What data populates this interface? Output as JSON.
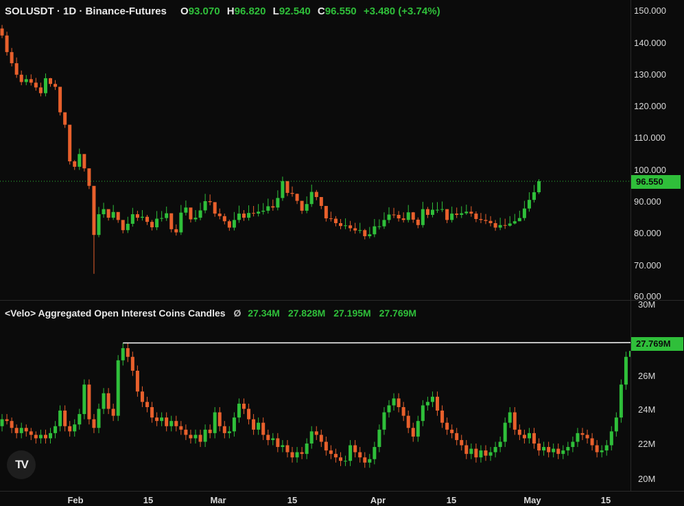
{
  "symbol_line": "SOLUSDT · 1D · Binance-Futures",
  "ohlc": {
    "o_label": "O",
    "o": "93.070",
    "h_label": "H",
    "h": "96.820",
    "l_label": "L",
    "l": "92.540",
    "c_label": "C",
    "c": "96.550",
    "change": "+3.480 (+3.74%)"
  },
  "price_axis_labels": [
    "150.000",
    "140.000",
    "130.000",
    "120.000",
    "110.000",
    "100.000",
    "90.000",
    "80.000",
    "70.000",
    "60.000"
  ],
  "current_price_tag": "96.550",
  "oi_legend": {
    "name": "<Velo> Aggregated Open Interest Coins Candles",
    "sep": "Ø",
    "o": "27.34M",
    "h": "27.828M",
    "l": "27.195M",
    "c": "27.769M"
  },
  "oi_axis_labels": [
    "30M",
    "26M",
    "24M",
    "22M",
    "20M"
  ],
  "current_oi_tag": "27.769M",
  "time_labels": [
    "Feb",
    "15",
    "Mar",
    "15",
    "Apr",
    "15",
    "May",
    "15"
  ],
  "logo_text": "TV",
  "colors": {
    "up": "#2fbf3a",
    "down": "#e8602c",
    "background": "#0b0b0b",
    "ref_line": "#ffffff"
  },
  "chart_data": [
    {
      "type": "candlestick",
      "title": "SOLUSDT · 1D · Binance-Futures",
      "ylim": [
        60,
        150
      ],
      "x": [
        "Jan 18",
        "Jan 19",
        "Jan 20",
        "Jan 21",
        "Jan 22",
        "Jan 23",
        "Jan 24",
        "Jan 25",
        "Jan 26",
        "Jan 27",
        "Jan 28",
        "Jan 29",
        "Jan 30",
        "Jan 31",
        "Feb 1",
        "Feb 2",
        "Feb 3",
        "Feb 4",
        "Feb 5",
        "Feb 6",
        "Feb 7",
        "Feb 8",
        "Feb 9",
        "Feb 10",
        "Feb 11",
        "Feb 12",
        "Feb 13",
        "Feb 14",
        "Feb 15",
        "Feb 16",
        "Feb 17",
        "Feb 18",
        "Feb 19",
        "Feb 20",
        "Feb 21",
        "Feb 22",
        "Feb 23",
        "Feb 24",
        "Feb 25",
        "Feb 26",
        "Feb 27",
        "Feb 28",
        "Mar 1",
        "Mar 2",
        "Mar 3",
        "Mar 4",
        "Mar 5",
        "Mar 6",
        "Mar 7",
        "Mar 8",
        "Mar 9",
        "Mar 10",
        "Mar 11",
        "Mar 12",
        "Mar 13",
        "Mar 14",
        "Mar 15",
        "Mar 16",
        "Mar 17",
        "Mar 18",
        "Mar 19",
        "Mar 20",
        "Mar 21",
        "Mar 22",
        "Mar 23",
        "Mar 24",
        "Mar 25",
        "Mar 26",
        "Mar 27",
        "Mar 28",
        "Mar 29",
        "Mar 30",
        "Mar 31",
        "Apr 1",
        "Apr 2",
        "Apr 3",
        "Apr 4",
        "Apr 5",
        "Apr 6",
        "Apr 7",
        "Apr 8",
        "Apr 9",
        "Apr 10",
        "Apr 11",
        "Apr 12",
        "Apr 13",
        "Apr 14",
        "Apr 15",
        "Apr 16",
        "Apr 17",
        "Apr 18",
        "Apr 19",
        "Apr 20",
        "Apr 21",
        "Apr 22",
        "Apr 23",
        "Apr 24",
        "Apr 25",
        "Apr 26",
        "Apr 27",
        "Apr 28",
        "Apr 29",
        "Apr 30",
        "May 1",
        "May 2",
        "May 3",
        "May 4",
        "May 5",
        "May 6",
        "May 7",
        "May 8",
        "May 9",
        "May 10",
        "May 11",
        "May 12",
        "May 13",
        "May 14",
        "May 15",
        "May 16",
        "May 17",
        "May 18",
        "May 19",
        "May 20",
        "May 21",
        "May 22",
        "May 23",
        "May 24",
        "May 25",
        "May 26",
        "May 27",
        "May 28",
        "May 29",
        "May 30",
        "May 31",
        "Jun 1",
        "Jun 2",
        "Jun 3",
        "Jun 4",
        "Jun 5",
        "Jun 6"
      ],
      "open": [
        144.5,
        142.3,
        137.1,
        133.6,
        130.0,
        127.7,
        128.6,
        127.5,
        126.0,
        124.2,
        128.9,
        127.1,
        126.2,
        118.2,
        114.3,
        102.8,
        101.1,
        105.1,
        100.6,
        95.1,
        79.7,
        86.2,
        87.8,
        85.1,
        86.9,
        84.4,
        81.2,
        83.2,
        86.2,
        85.1,
        85.4,
        83.8,
        82.1,
        84.8,
        85.0,
        86.5,
        81.5,
        80.5,
        86.7,
        88.3,
        84.6,
        85.1,
        87.4,
        90.3,
        90.0,
        86.4,
        85.6,
        84.0,
        82.0,
        84.4,
        86.4,
        85.1,
        86.6,
        86.4,
        87.0,
        87.3,
        88.7,
        88.3,
        91.3,
        96.6,
        92.9,
        92.6,
        90.4,
        87.3,
        89.4,
        93.2,
        91.6,
        88.8,
        84.9,
        84.8,
        83.4,
        82.5,
        82.7,
        81.8,
        81.1,
        81.2,
        79.3,
        79.9,
        82.4,
        82.4,
        84.4,
        86.1,
        86.0,
        84.9,
        84.4,
        86.8,
        84.5,
        82.8,
        87.8,
        86.0,
        87.6,
        87.6,
        87.8,
        84.4,
        86.4,
        86.0,
        86.5,
        87.0,
        86.4,
        84.7,
        84.4,
        84.1,
        83.4,
        82.0,
        82.8,
        82.6,
        83.3,
        84.0,
        85.0,
        88.0,
        90.7,
        93.1
      ],
      "close": [
        142.3,
        137.1,
        133.6,
        130.0,
        127.7,
        128.6,
        127.5,
        126.0,
        124.2,
        128.9,
        127.1,
        126.2,
        118.2,
        114.3,
        102.8,
        101.1,
        105.1,
        100.6,
        95.1,
        79.7,
        86.2,
        87.8,
        85.1,
        86.9,
        84.4,
        81.2,
        83.2,
        86.2,
        85.1,
        85.4,
        83.8,
        82.1,
        84.8,
        85.0,
        86.5,
        81.5,
        80.5,
        86.7,
        88.3,
        84.6,
        85.1,
        87.4,
        90.3,
        90.0,
        86.4,
        85.6,
        84.0,
        82.0,
        84.4,
        86.4,
        85.1,
        86.6,
        86.4,
        87.0,
        87.3,
        88.7,
        88.3,
        91.3,
        96.6,
        92.9,
        92.6,
        90.4,
        87.3,
        89.4,
        93.2,
        91.6,
        88.8,
        84.9,
        84.8,
        83.4,
        82.5,
        82.7,
        81.8,
        81.1,
        81.2,
        79.3,
        79.9,
        82.4,
        82.4,
        84.4,
        86.1,
        86.0,
        84.9,
        84.4,
        86.8,
        84.5,
        82.8,
        87.8,
        86.0,
        87.6,
        87.6,
        87.8,
        84.4,
        86.4,
        86.0,
        86.5,
        87.0,
        86.4,
        84.7,
        84.4,
        84.1,
        83.4,
        82.0,
        82.8,
        82.6,
        83.3,
        84.0,
        85.0,
        88.0,
        90.7,
        93.1,
        96.55
      ],
      "high": [
        145.6,
        143.5,
        138.4,
        135.4,
        131.3,
        129.9,
        130.1,
        129.0,
        127.5,
        130.4,
        129.0,
        128.3,
        120.0,
        116.3,
        104.5,
        103.2,
        106.8,
        102.6,
        97.1,
        90.0,
        88.5,
        89.8,
        87.6,
        89.1,
        86.6,
        83.7,
        85.4,
        88.2,
        87.3,
        87.5,
        86.0,
        84.4,
        87.2,
        87.2,
        88.6,
        84.1,
        83.0,
        89.1,
        90.5,
        87.0,
        87.5,
        89.8,
        92.6,
        92.4,
        88.9,
        88.0,
        86.4,
        84.5,
        86.9,
        88.9,
        87.5,
        89.0,
        88.8,
        89.4,
        89.7,
        91.1,
        90.8,
        93.7,
        98.0,
        95.2,
        94.9,
        92.7,
        89.8,
        91.8,
        95.5,
        93.8,
        91.1,
        87.3,
        87.0,
        85.6,
        84.7,
        84.9,
        84.1,
        83.5,
        83.5,
        81.6,
        82.2,
        84.7,
        84.6,
        86.8,
        88.4,
        88.2,
        87.2,
        86.8,
        89.1,
        86.9,
        85.2,
        90.1,
        88.5,
        89.9,
        90.0,
        90.2,
        86.8,
        88.6,
        88.3,
        88.7,
        89.2,
        88.7,
        87.1,
        86.6,
        86.3,
        85.6,
        84.4,
        85.1,
        84.8,
        85.6,
        86.3,
        87.3,
        90.4,
        93.1,
        95.4,
        97.2
      ],
      "low": [
        141.5,
        136.0,
        132.6,
        129.0,
        126.7,
        126.7,
        126.6,
        125.0,
        123.2,
        123.2,
        126.2,
        125.2,
        117.2,
        113.3,
        101.8,
        100.1,
        100.1,
        99.6,
        94.1,
        67.5,
        79.0,
        85.1,
        84.2,
        84.4,
        83.5,
        80.2,
        80.3,
        82.3,
        84.1,
        84.2,
        82.8,
        81.1,
        81.2,
        83.9,
        84.1,
        80.5,
        79.5,
        79.7,
        85.8,
        83.6,
        83.8,
        84.3,
        86.5,
        89.0,
        85.4,
        84.6,
        83.0,
        81.0,
        81.1,
        83.5,
        84.1,
        84.2,
        85.5,
        85.5,
        86.1,
        86.4,
        87.3,
        87.4,
        90.4,
        91.9,
        91.7,
        89.4,
        86.3,
        86.5,
        88.5,
        90.6,
        87.8,
        83.9,
        83.9,
        82.4,
        81.5,
        81.5,
        80.8,
        80.1,
        80.2,
        78.3,
        78.6,
        79.0,
        81.4,
        81.6,
        83.4,
        85.0,
        83.9,
        83.6,
        83.6,
        83.5,
        81.8,
        82.0,
        85.0,
        85.2,
        86.6,
        86.9,
        83.4,
        83.6,
        85.0,
        85.0,
        86.0,
        85.4,
        83.7,
        83.4,
        83.1,
        82.4,
        81.0,
        81.2,
        81.6,
        82.3,
        83.0,
        84.0,
        84.2,
        87.0,
        89.9,
        92.54
      ]
    },
    {
      "type": "candlestick",
      "title": "<Velo> Aggregated Open Interest Coins Candles",
      "ylim": [
        20,
        30
      ],
      "unit": "M",
      "open": [
        23.0,
        23.4,
        23.3,
        22.9,
        22.6,
        22.9,
        22.7,
        22.5,
        22.3,
        22.5,
        22.3,
        22.6,
        23.0,
        23.9,
        23.0,
        22.7,
        23.1,
        23.7,
        25.4,
        23.4,
        22.9,
        24.0,
        24.9,
        24.0,
        23.6,
        26.8,
        27.5,
        27.0,
        26.2,
        25.0,
        24.4,
        24.1,
        23.5,
        23.3,
        23.5,
        23.0,
        23.3,
        23.0,
        22.8,
        22.5,
        22.3,
        22.5,
        22.1,
        22.8,
        22.6,
        23.8,
        23.0,
        22.6,
        22.7,
        23.5,
        24.3,
        24.0,
        23.4,
        22.8,
        23.2,
        22.5,
        22.2,
        22.3,
        21.8,
        21.9,
        21.5,
        21.2,
        21.5,
        21.4,
        22.0,
        22.7,
        22.5,
        22.1,
        21.6,
        21.4,
        21.2,
        21.0,
        21.0,
        21.9,
        21.5,
        21.2,
        20.9,
        21.1,
        21.8,
        22.8,
        23.8,
        24.2,
        24.6,
        24.1,
        23.6,
        22.9,
        22.4,
        23.3,
        24.2,
        24.4,
        24.7,
        23.9,
        23.2,
        22.8,
        22.6,
        22.2,
        21.9,
        21.4,
        21.7,
        21.2,
        21.6,
        21.3,
        21.5,
        21.8,
        22.1,
        23.2,
        23.8,
        22.8,
        22.5,
        22.3,
        22.6,
        22.0,
        21.6,
        21.8,
        21.5,
        21.7,
        21.4,
        21.6,
        21.8,
        22.1,
        22.6,
        22.5,
        22.3,
        21.9,
        21.5,
        21.6,
        21.9,
        22.7,
        23.5,
        25.4,
        27.0,
        27.34
      ],
      "close": [
        23.4,
        23.3,
        22.9,
        22.6,
        22.9,
        22.7,
        22.5,
        22.3,
        22.5,
        22.3,
        22.6,
        23.0,
        23.9,
        23.0,
        22.7,
        23.1,
        23.7,
        25.4,
        23.4,
        22.9,
        24.0,
        24.9,
        24.0,
        23.6,
        26.8,
        27.5,
        27.0,
        26.2,
        25.0,
        24.4,
        24.1,
        23.5,
        23.3,
        23.5,
        23.0,
        23.3,
        23.0,
        22.8,
        22.5,
        22.3,
        22.5,
        22.1,
        22.8,
        22.6,
        23.8,
        23.0,
        22.6,
        22.7,
        23.5,
        24.3,
        24.0,
        23.4,
        22.8,
        23.2,
        22.5,
        22.2,
        22.3,
        21.8,
        21.9,
        21.5,
        21.2,
        21.5,
        21.4,
        22.0,
        22.7,
        22.5,
        22.1,
        21.6,
        21.4,
        21.2,
        21.0,
        21.0,
        21.9,
        21.5,
        21.2,
        20.9,
        21.1,
        21.8,
        22.8,
        23.8,
        24.2,
        24.6,
        24.1,
        23.6,
        22.9,
        22.4,
        23.3,
        24.2,
        24.4,
        24.7,
        23.9,
        23.2,
        22.8,
        22.6,
        22.2,
        21.9,
        21.4,
        21.7,
        21.2,
        21.6,
        21.3,
        21.5,
        21.8,
        22.1,
        23.2,
        23.8,
        22.8,
        22.5,
        22.3,
        22.6,
        22.0,
        21.6,
        21.8,
        21.5,
        21.7,
        21.4,
        21.6,
        21.8,
        22.1,
        22.6,
        22.5,
        22.3,
        21.9,
        21.5,
        21.6,
        21.9,
        22.7,
        23.5,
        25.4,
        27.0,
        27.34,
        27.769
      ],
      "high": [
        23.7,
        23.7,
        23.5,
        23.1,
        23.2,
        23.1,
        22.9,
        22.7,
        22.8,
        22.8,
        22.9,
        23.3,
        24.2,
        24.2,
        23.3,
        23.4,
        24.0,
        25.7,
        25.7,
        23.7,
        24.3,
        25.2,
        25.2,
        24.3,
        27.1,
        27.8,
        27.8,
        27.3,
        26.5,
        25.3,
        24.7,
        24.4,
        23.8,
        23.8,
        23.8,
        23.6,
        23.6,
        23.3,
        23.1,
        22.8,
        22.8,
        22.8,
        23.1,
        23.1,
        24.1,
        24.1,
        23.3,
        23.0,
        23.8,
        24.6,
        24.6,
        24.3,
        23.7,
        23.5,
        23.5,
        22.8,
        22.6,
        22.6,
        22.2,
        22.2,
        21.8,
        21.8,
        21.8,
        22.3,
        23.0,
        23.0,
        22.8,
        22.4,
        21.9,
        21.7,
        21.5,
        21.3,
        22.2,
        22.2,
        21.8,
        21.5,
        21.4,
        22.1,
        23.1,
        24.1,
        24.5,
        24.9,
        24.9,
        24.4,
        23.9,
        23.2,
        23.6,
        24.5,
        24.7,
        25.0,
        25.0,
        24.2,
        23.5,
        23.1,
        22.9,
        22.5,
        22.2,
        22.0,
        22.0,
        21.9,
        21.9,
        21.8,
        22.1,
        22.4,
        23.5,
        24.1,
        24.1,
        23.1,
        22.8,
        22.9,
        22.9,
        22.3,
        22.1,
        22.1,
        22.0,
        22.0,
        21.9,
        22.1,
        22.4,
        22.9,
        22.9,
        22.8,
        22.6,
        22.2,
        21.9,
        22.2,
        23.0,
        23.8,
        25.7,
        27.3,
        27.6,
        27.828
      ],
      "low": [
        22.7,
        23.1,
        22.6,
        22.3,
        22.3,
        22.4,
        22.2,
        22.0,
        22.0,
        22.0,
        22.0,
        22.3,
        22.7,
        22.7,
        22.4,
        22.4,
        22.8,
        23.4,
        23.1,
        22.6,
        22.6,
        23.7,
        23.7,
        23.3,
        23.3,
        26.5,
        26.7,
        25.9,
        24.7,
        24.1,
        23.8,
        23.2,
        23.0,
        23.0,
        22.7,
        22.7,
        22.7,
        22.5,
        22.2,
        22.0,
        22.0,
        21.8,
        21.8,
        22.3,
        22.3,
        22.7,
        22.3,
        22.3,
        22.4,
        23.2,
        23.7,
        23.1,
        22.5,
        22.5,
        22.2,
        21.9,
        21.9,
        21.5,
        21.5,
        21.2,
        20.9,
        20.9,
        21.1,
        21.1,
        21.7,
        22.2,
        21.8,
        21.3,
        21.1,
        20.9,
        20.7,
        20.7,
        20.7,
        21.2,
        20.9,
        20.6,
        20.6,
        20.8,
        21.5,
        22.5,
        23.5,
        23.9,
        23.8,
        23.3,
        22.6,
        22.1,
        22.1,
        23.0,
        23.9,
        24.1,
        23.6,
        22.9,
        22.5,
        22.3,
        21.9,
        21.6,
        21.1,
        21.1,
        20.9,
        20.9,
        21.0,
        21.0,
        21.2,
        21.5,
        21.8,
        22.9,
        22.5,
        22.2,
        22.0,
        22.0,
        21.7,
        21.3,
        21.3,
        21.2,
        21.2,
        21.1,
        21.1,
        21.3,
        21.5,
        21.8,
        22.2,
        22.0,
        21.6,
        21.2,
        21.2,
        21.3,
        21.6,
        22.4,
        23.2,
        25.1,
        26.7,
        27.195
      ]
    }
  ]
}
